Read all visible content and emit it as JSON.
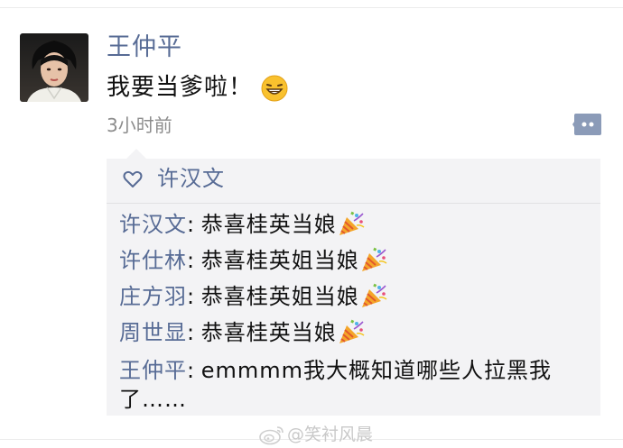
{
  "post": {
    "author": "王仲平",
    "text": "我要当爹啦！",
    "emoji_icon": "grinning-face-icon",
    "timestamp": "3小时前",
    "more_icon": "more-comment-icon"
  },
  "likes": {
    "icon": "heart-icon",
    "names": "许汉文"
  },
  "comments": [
    {
      "author": "许汉文",
      "sep": ": ",
      "text": "恭喜桂英当娘",
      "emoji_icon": "party-popper-icon"
    },
    {
      "author": "许仕林",
      "sep": ": ",
      "text": "恭喜桂英姐当娘",
      "emoji_icon": "party-popper-icon"
    },
    {
      "author": "庄方羽",
      "sep": ": ",
      "text": "恭喜桂英姐当娘",
      "emoji_icon": "party-popper-icon"
    },
    {
      "author": "周世显",
      "sep": ": ",
      "text": "恭喜桂英当娘",
      "emoji_icon": "party-popper-icon"
    },
    {
      "author": "王仲平",
      "sep": ": ",
      "text": "emmmm我大概知道哪些人拉黑我了……"
    }
  ],
  "watermark": {
    "text": "@笑衬风晨",
    "icon": "weibo-logo-icon"
  },
  "colors": {
    "name_blue": "#576b95",
    "panel_bg": "#f3f3f5",
    "timestamp_gray": "#8c8c8c"
  }
}
